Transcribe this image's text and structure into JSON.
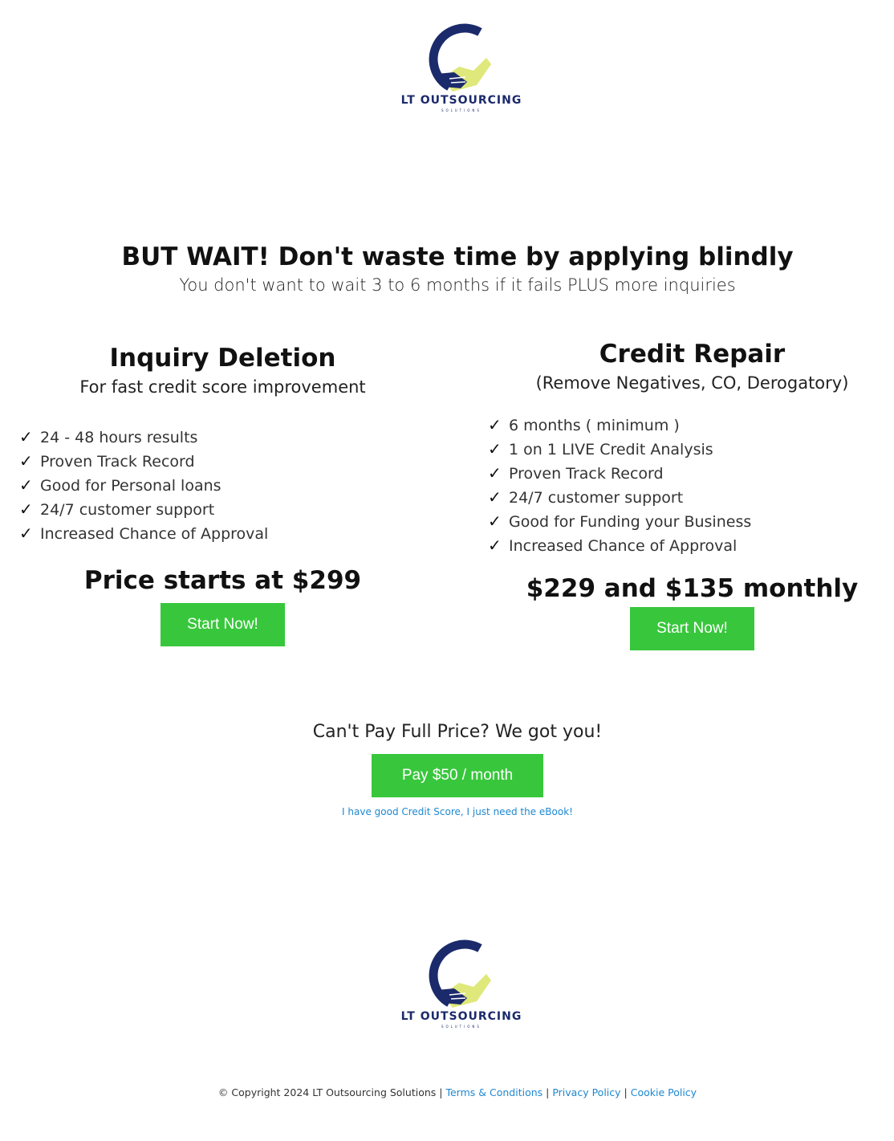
{
  "header_logo": {
    "brand_lt": "LT",
    "brand_out": "OUTSOURCING",
    "tagline": "SOLUTIONS",
    "colors": {
      "navy": "#1b2a6b",
      "lime": "#dfe87a"
    }
  },
  "hero": {
    "headline": "BUT WAIT! Don't waste time by applying blindly",
    "subhead": "You don't want to wait 3 to 6 months if it fails PLUS more inquiries"
  },
  "inquiry_deletion": {
    "title": "Inquiry Deletion",
    "subtitle": "For fast credit score improvement",
    "features": [
      "24 - 48 hours results",
      "Proven Track Record",
      "Good for Personal loans",
      "24/7 customer support",
      "Increased Chance of Approval"
    ],
    "price": "Price starts at $299",
    "button": "Start Now!"
  },
  "credit_repair": {
    "title": "Credit Repair",
    "subtitle": "(Remove Negatives, CO, Derogatory)",
    "features": [
      "6 months ( minimum )",
      "1 on 1 LIVE Credit Analysis",
      "Proven Track Record",
      "24/7 customer support",
      "Good for Funding your Business",
      "Increased Chance of Approval"
    ],
    "price": "$229 and $135 monthly",
    "button": "Start Now!"
  },
  "payment_plan": {
    "prompt": "Can't Pay Full Price? We got you!",
    "button": "Pay $50 / month",
    "ebook_link": "I have good Credit Score, I just need the eBook!"
  },
  "footer": {
    "copyright": "© Copyright 2024 LT Outsourcing Solutions",
    "sep": "|",
    "terms": "Terms & Conditions",
    "privacy": "Privacy Policy",
    "cookie": "Cookie Policy"
  },
  "check_glyph": "✓",
  "accent_green": "#38c73c",
  "link_blue": "#1e88d0"
}
